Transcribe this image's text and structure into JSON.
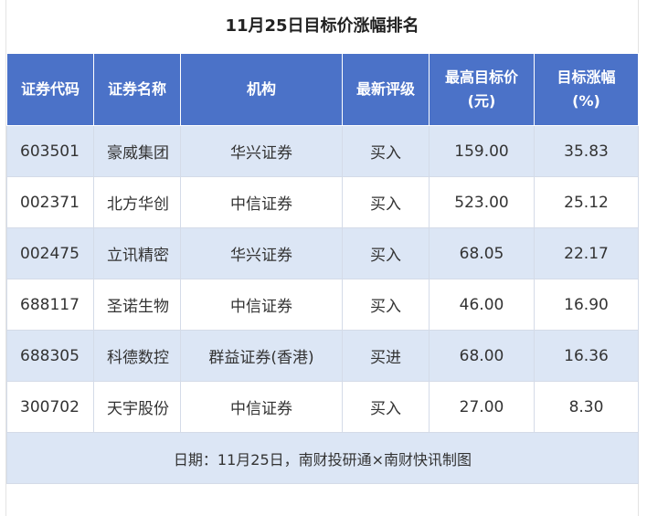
{
  "title": "11月25日目标价涨幅排名",
  "columns": {
    "code": "证券代码",
    "name": "证券名称",
    "org": "机构",
    "rating": "最新评级",
    "target_line1": "最高目标价",
    "target_line2": "(元)",
    "rise_line1": "目标涨幅",
    "rise_line2": "(%)"
  },
  "rows": [
    {
      "code": "603501",
      "name": "豪威集团",
      "org": "华兴证券",
      "rating": "买入",
      "target": "159.00",
      "rise": "35.83"
    },
    {
      "code": "002371",
      "name": "北方华创",
      "org": "中信证券",
      "rating": "买入",
      "target": "523.00",
      "rise": "25.12"
    },
    {
      "code": "002475",
      "name": "立讯精密",
      "org": "华兴证券",
      "rating": "买入",
      "target": "68.05",
      "rise": "22.17"
    },
    {
      "code": "688117",
      "name": "圣诺生物",
      "org": "中信证券",
      "rating": "买入",
      "target": "46.00",
      "rise": "16.90"
    },
    {
      "code": "688305",
      "name": "科德数控",
      "org": "群益证券(香港)",
      "rating": "买进",
      "target": "68.00",
      "rise": "16.36"
    },
    {
      "code": "300702",
      "name": "天宇股份",
      "org": "中信证券",
      "rating": "买入",
      "target": "27.00",
      "rise": "8.30"
    }
  ],
  "footer": "日期：11月25日，南财投研通×南财快讯制图"
}
